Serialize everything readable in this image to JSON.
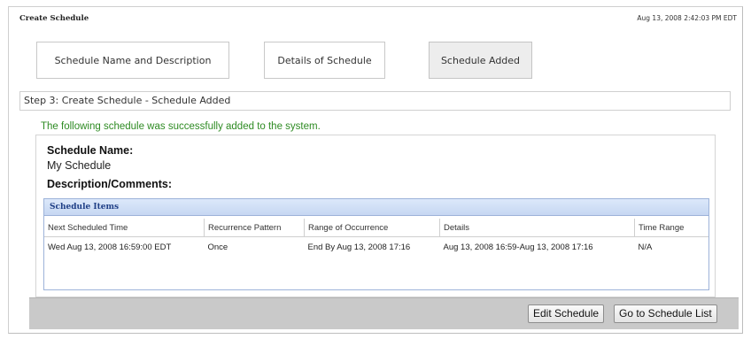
{
  "header": {
    "title": "Create Schedule",
    "timestamp": "Aug 13, 2008 2:42:03 PM EDT"
  },
  "wizard": {
    "steps": [
      {
        "label": "Schedule Name and Description"
      },
      {
        "label": "Details of Schedule"
      },
      {
        "label": "Schedule Added",
        "active": true
      }
    ],
    "step_title": "Step 3: Create Schedule - Schedule Added"
  },
  "result": {
    "success_message": "The following schedule was successfully added to the system.",
    "name_label": "Schedule Name:",
    "name_value": "My Schedule",
    "description_label": "Description/Comments:"
  },
  "schedule_items": {
    "title": "Schedule Items",
    "columns": [
      "Next Scheduled Time",
      "Recurrence Pattern",
      "Range of Occurrence",
      "Details",
      "Time Range"
    ],
    "rows": [
      [
        "Wed Aug 13, 2008 16:59:00 EDT",
        "Once",
        "End By Aug 13, 2008 17:16",
        "Aug 13, 2008 16:59-Aug 13, 2008 17:16",
        "N/A"
      ]
    ]
  },
  "actions": {
    "edit_label": "Edit Schedule",
    "list_label": "Go to Schedule List"
  },
  "colors": {
    "success_text": "#2e8b23",
    "panel_header": "#c6d7f2",
    "panel_title": "#1f3f86",
    "button_bar": "#c9c9c9"
  }
}
